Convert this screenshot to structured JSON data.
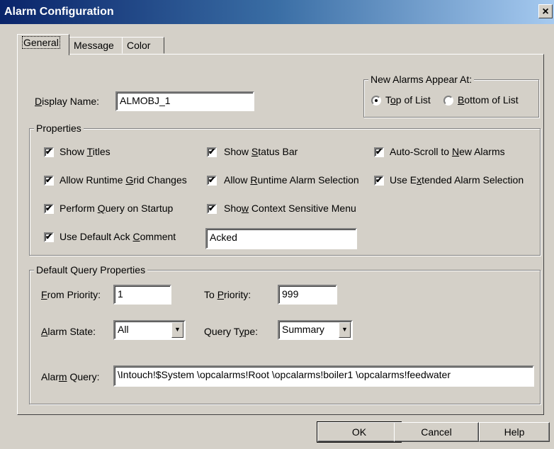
{
  "window": {
    "title": "Alarm Configuration",
    "close": "×"
  },
  "tabs": [
    {
      "label": "General",
      "active": true
    },
    {
      "label": "Message",
      "active": false
    },
    {
      "label": "Color",
      "active": false
    }
  ],
  "display_name": {
    "label_pre": "",
    "label_u": "D",
    "label_post": "isplay Name:",
    "value": "ALMOBJ_1"
  },
  "new_alarms": {
    "legend": "New Alarms Appear At:",
    "options": [
      {
        "pre": "T",
        "u": "o",
        "post": "p of List",
        "selected": true
      },
      {
        "pre": "",
        "u": "B",
        "post": "ottom of List",
        "selected": false
      }
    ]
  },
  "properties": {
    "legend": "Properties",
    "checks": [
      {
        "pre": "Show ",
        "u": "T",
        "post": "itles",
        "checked": true
      },
      {
        "pre": "Show ",
        "u": "S",
        "post": "tatus Bar",
        "checked": true
      },
      {
        "pre": "Auto-Scroll to ",
        "u": "N",
        "post": "ew Alarms",
        "checked": true
      },
      {
        "pre": "Allow Runtime ",
        "u": "G",
        "post": "rid Changes",
        "checked": true
      },
      {
        "pre": "Allow ",
        "u": "R",
        "post": "untime Alarm Selection",
        "checked": true
      },
      {
        "pre": "Use E",
        "u": "x",
        "post": "tended Alarm Selection",
        "checked": true
      },
      {
        "pre": "Perform ",
        "u": "Q",
        "post": "uery on Startup",
        "checked": true
      },
      {
        "pre": "Sho",
        "u": "w",
        "post": " Context Sensitive Menu",
        "checked": true
      },
      {
        "pre": "Use Default Ack ",
        "u": "C",
        "post": "omment",
        "checked": true
      }
    ],
    "check_mark": "✔",
    "ack_comment": "Acked"
  },
  "query": {
    "legend": "Default Query Properties",
    "from_priority": {
      "pre": "",
      "u": "F",
      "post": "rom Priority:",
      "value": "1"
    },
    "to_priority": {
      "pre": "To ",
      "u": "P",
      "post": "riority:",
      "value": "999"
    },
    "alarm_state": {
      "pre": "",
      "u": "A",
      "post": "larm State:",
      "value": "All"
    },
    "query_type": {
      "pre": "Query T",
      "u": "y",
      "post": "pe:",
      "value": "Summary"
    },
    "alarm_query": {
      "pre": "Alar",
      "u": "m",
      "post": " Query:",
      "value": "\\Intouch!$System \\opcalarms!Root \\opcalarms!boiler1 \\opcalarms!feedwater"
    },
    "arrow": "▼"
  },
  "buttons": {
    "ok": "OK",
    "cancel": "Cancel",
    "help": "Help"
  }
}
